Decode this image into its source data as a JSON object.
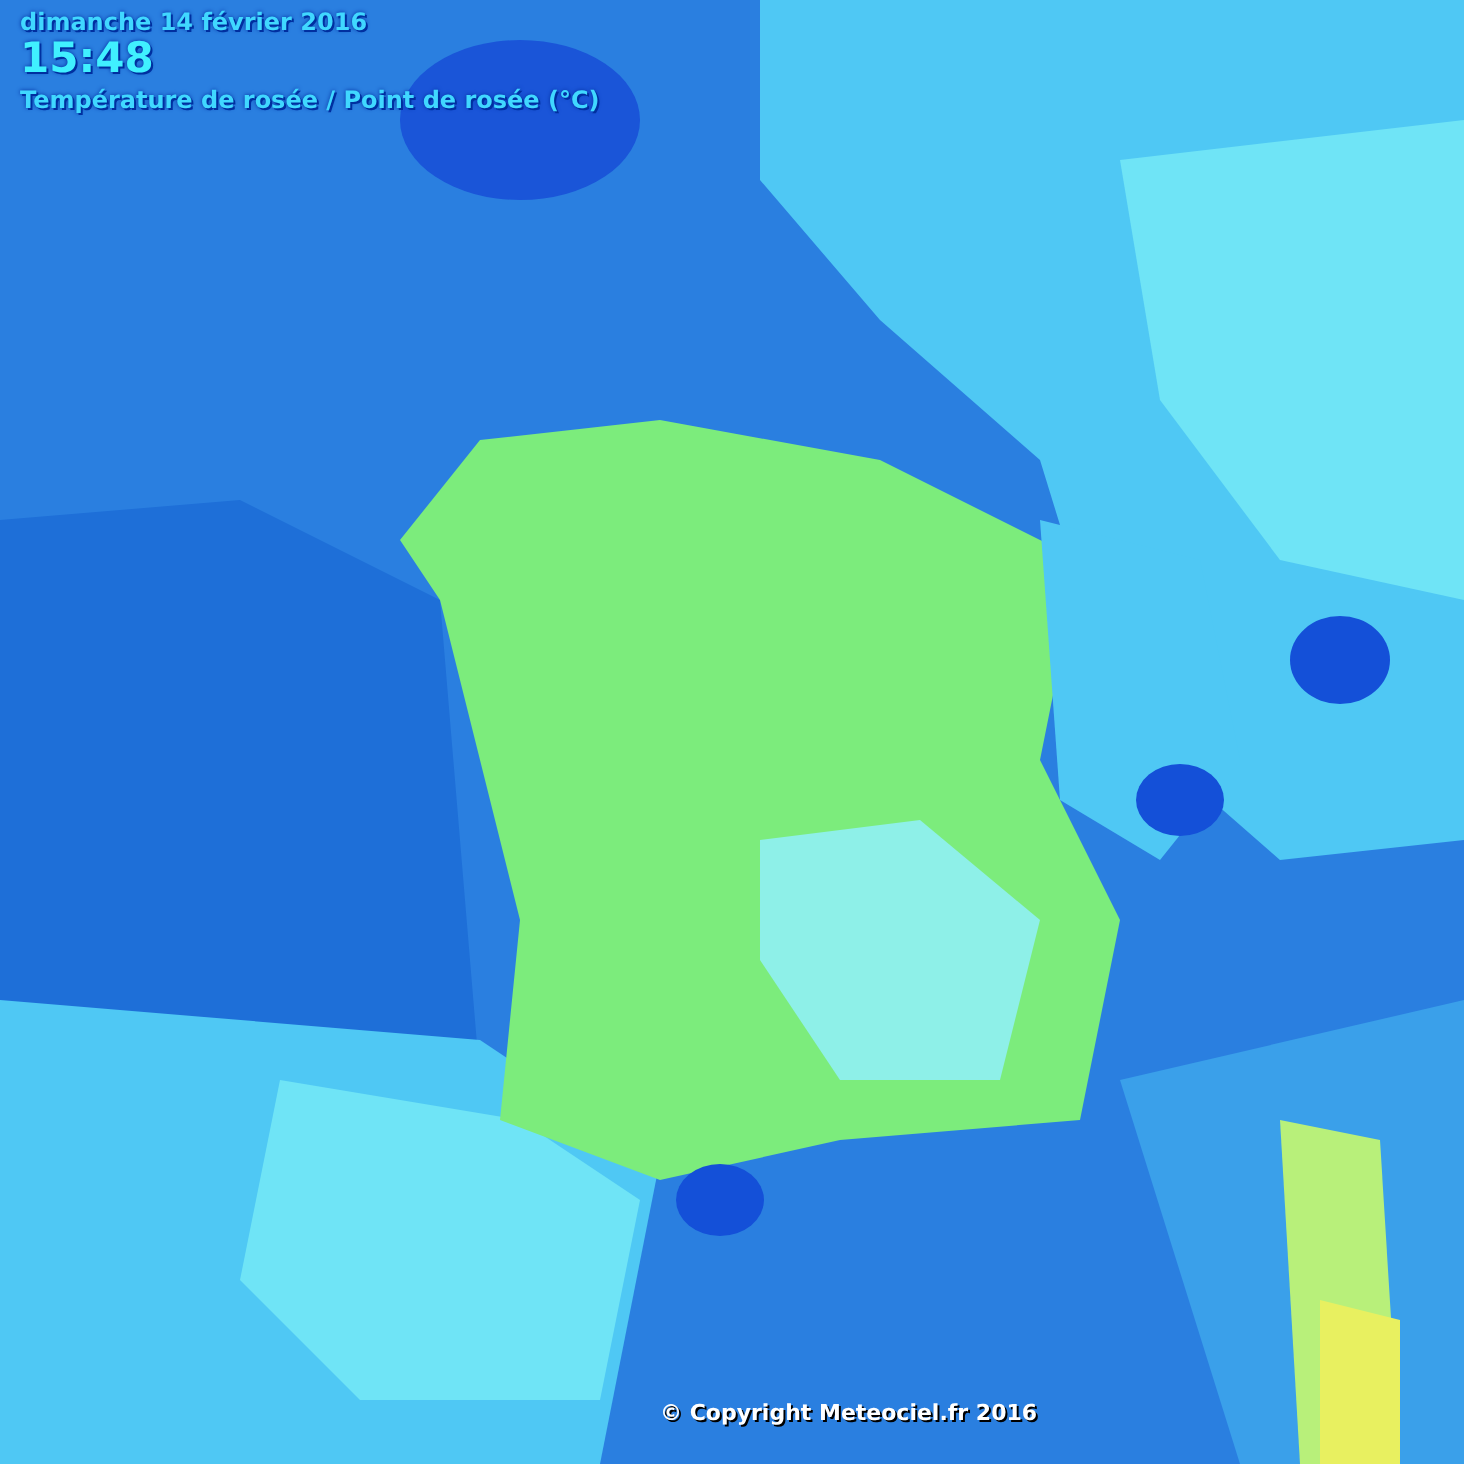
{
  "header": {
    "date": "dimanche 14 février 2016",
    "time": "15:48",
    "title": "Température de rosée / Point de rosée (°C)"
  },
  "footer": {
    "copyright": "© Copyright Meteociel.fr 2016"
  }
}
